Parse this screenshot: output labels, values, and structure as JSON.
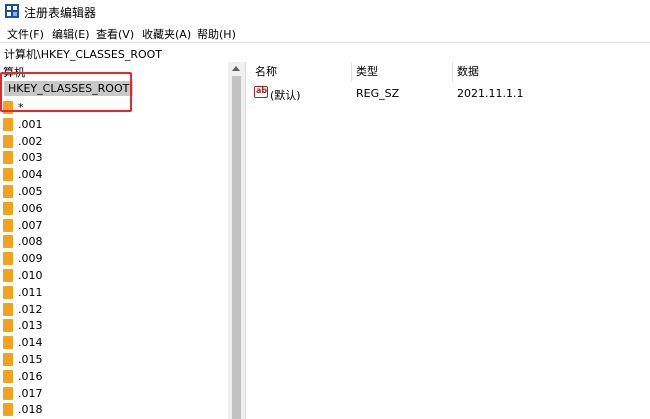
{
  "window": {
    "title": "注册表编辑器"
  },
  "menu": [
    "文件(F)",
    "编辑(E)",
    "查看(V)",
    "收藏夹(A)",
    "帮助(H)"
  ],
  "address": {
    "path": "计算机\\HKEY_CLASSES_ROOT"
  },
  "tree": {
    "computer_label": "算机",
    "root_key": "HKEY_CLASSES_ROOT",
    "children": [
      "*",
      ".001",
      ".002",
      ".003",
      ".004",
      ".005",
      ".006",
      ".007",
      ".008",
      ".009",
      ".010",
      ".011",
      ".012",
      ".013",
      ".014",
      ".015",
      ".016",
      ".017",
      ".018"
    ]
  },
  "list": {
    "columns": [
      "名称",
      "类型",
      "数据"
    ],
    "rows": [
      {
        "icon": "string-value-icon",
        "name": "(默认)",
        "type": "REG_SZ",
        "data": "2021.11.1.1"
      }
    ]
  },
  "colors": {
    "highlight_border": "#e8262b",
    "folder": "#f2a21b",
    "selection": "#c8c8c8"
  }
}
